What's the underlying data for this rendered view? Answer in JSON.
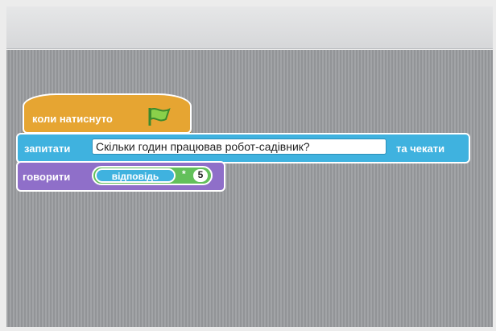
{
  "blocks": {
    "hat": {
      "label": "коли натиснуто",
      "icon": "green-flag-icon",
      "color": "#e6a532"
    },
    "ask": {
      "label_before": "запитати",
      "question": "Скільки годин працював робот-садівник?",
      "label_after": "та чекати",
      "color": "#3fb2df"
    },
    "say": {
      "label": "говорити",
      "reporter": "відповідь",
      "operator": "*",
      "number": "5",
      "color": "#8f6fc9",
      "operator_color": "#63c05b"
    }
  }
}
